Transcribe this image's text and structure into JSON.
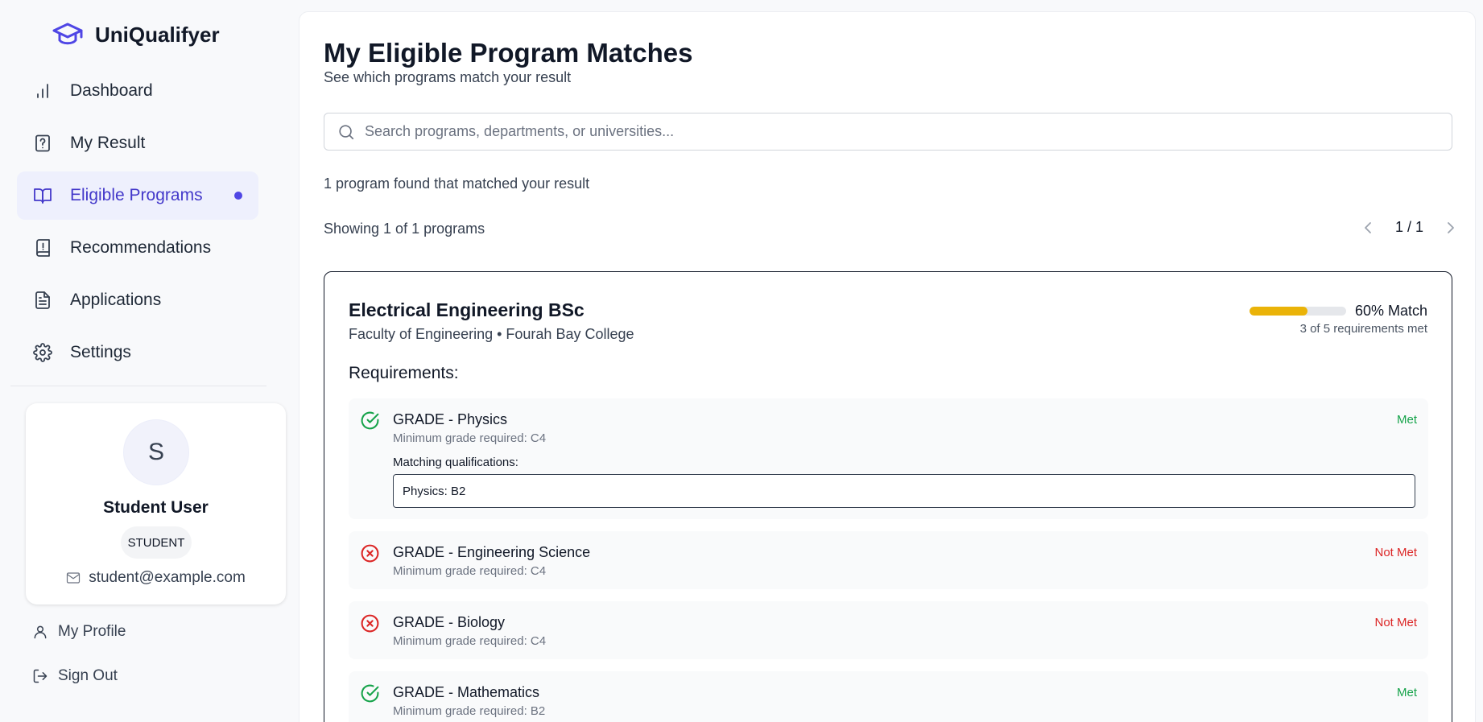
{
  "app": {
    "name": "UniQualifyer"
  },
  "sidebar": {
    "items": [
      {
        "label": "Dashboard",
        "icon": "bar-chart-icon"
      },
      {
        "label": "My Result",
        "icon": "help-file-icon"
      },
      {
        "label": "Eligible Programs",
        "icon": "open-book-icon",
        "active": true
      },
      {
        "label": "Recommendations",
        "icon": "book-alert-icon"
      },
      {
        "label": "Applications",
        "icon": "document-icon"
      },
      {
        "label": "Settings",
        "icon": "gear-icon"
      }
    ],
    "profile": {
      "avatar_initial": "S",
      "name": "Student User",
      "role": "STUDENT",
      "email": "student@example.com"
    },
    "links": {
      "my_profile": "My Profile",
      "sign_out": "Sign Out"
    }
  },
  "main": {
    "title": "My Eligible Program Matches",
    "subtitle": "See which programs match your result",
    "search": {
      "placeholder": "Search programs, departments, or universities...",
      "value": ""
    },
    "found_text": "1 program found that matched your result",
    "showing_text": "Showing 1 of 1 programs",
    "pagination": {
      "label": "1 / 1"
    },
    "program": {
      "title": "Electrical Engineering BSc",
      "subtitle": "Faculty of Engineering • Fourah Bay College",
      "match_percent": 60,
      "match_label": "60% Match",
      "requirements_met": "3 of 5 requirements met",
      "requirements_heading": "Requirements:",
      "requirements": [
        {
          "title": "GRADE - Physics",
          "min": "Minimum grade required: C4",
          "status": "Met",
          "met": true,
          "matching_label": "Matching qualifications:",
          "matching_value": "Physics: B2"
        },
        {
          "title": "GRADE - Engineering Science",
          "min": "Minimum grade required: C4",
          "status": "Not Met",
          "met": false
        },
        {
          "title": "GRADE - Biology",
          "min": "Minimum grade required: C4",
          "status": "Not Met",
          "met": false
        },
        {
          "title": "GRADE - Mathematics",
          "min": "Minimum grade required: B2",
          "status": "Met",
          "met": true
        }
      ]
    }
  },
  "colors": {
    "accent": "#4f46e5",
    "active_bg": "#eef0fd",
    "met": "#16a34a",
    "not_met": "#dc2626",
    "match_bar": "#eab308"
  }
}
